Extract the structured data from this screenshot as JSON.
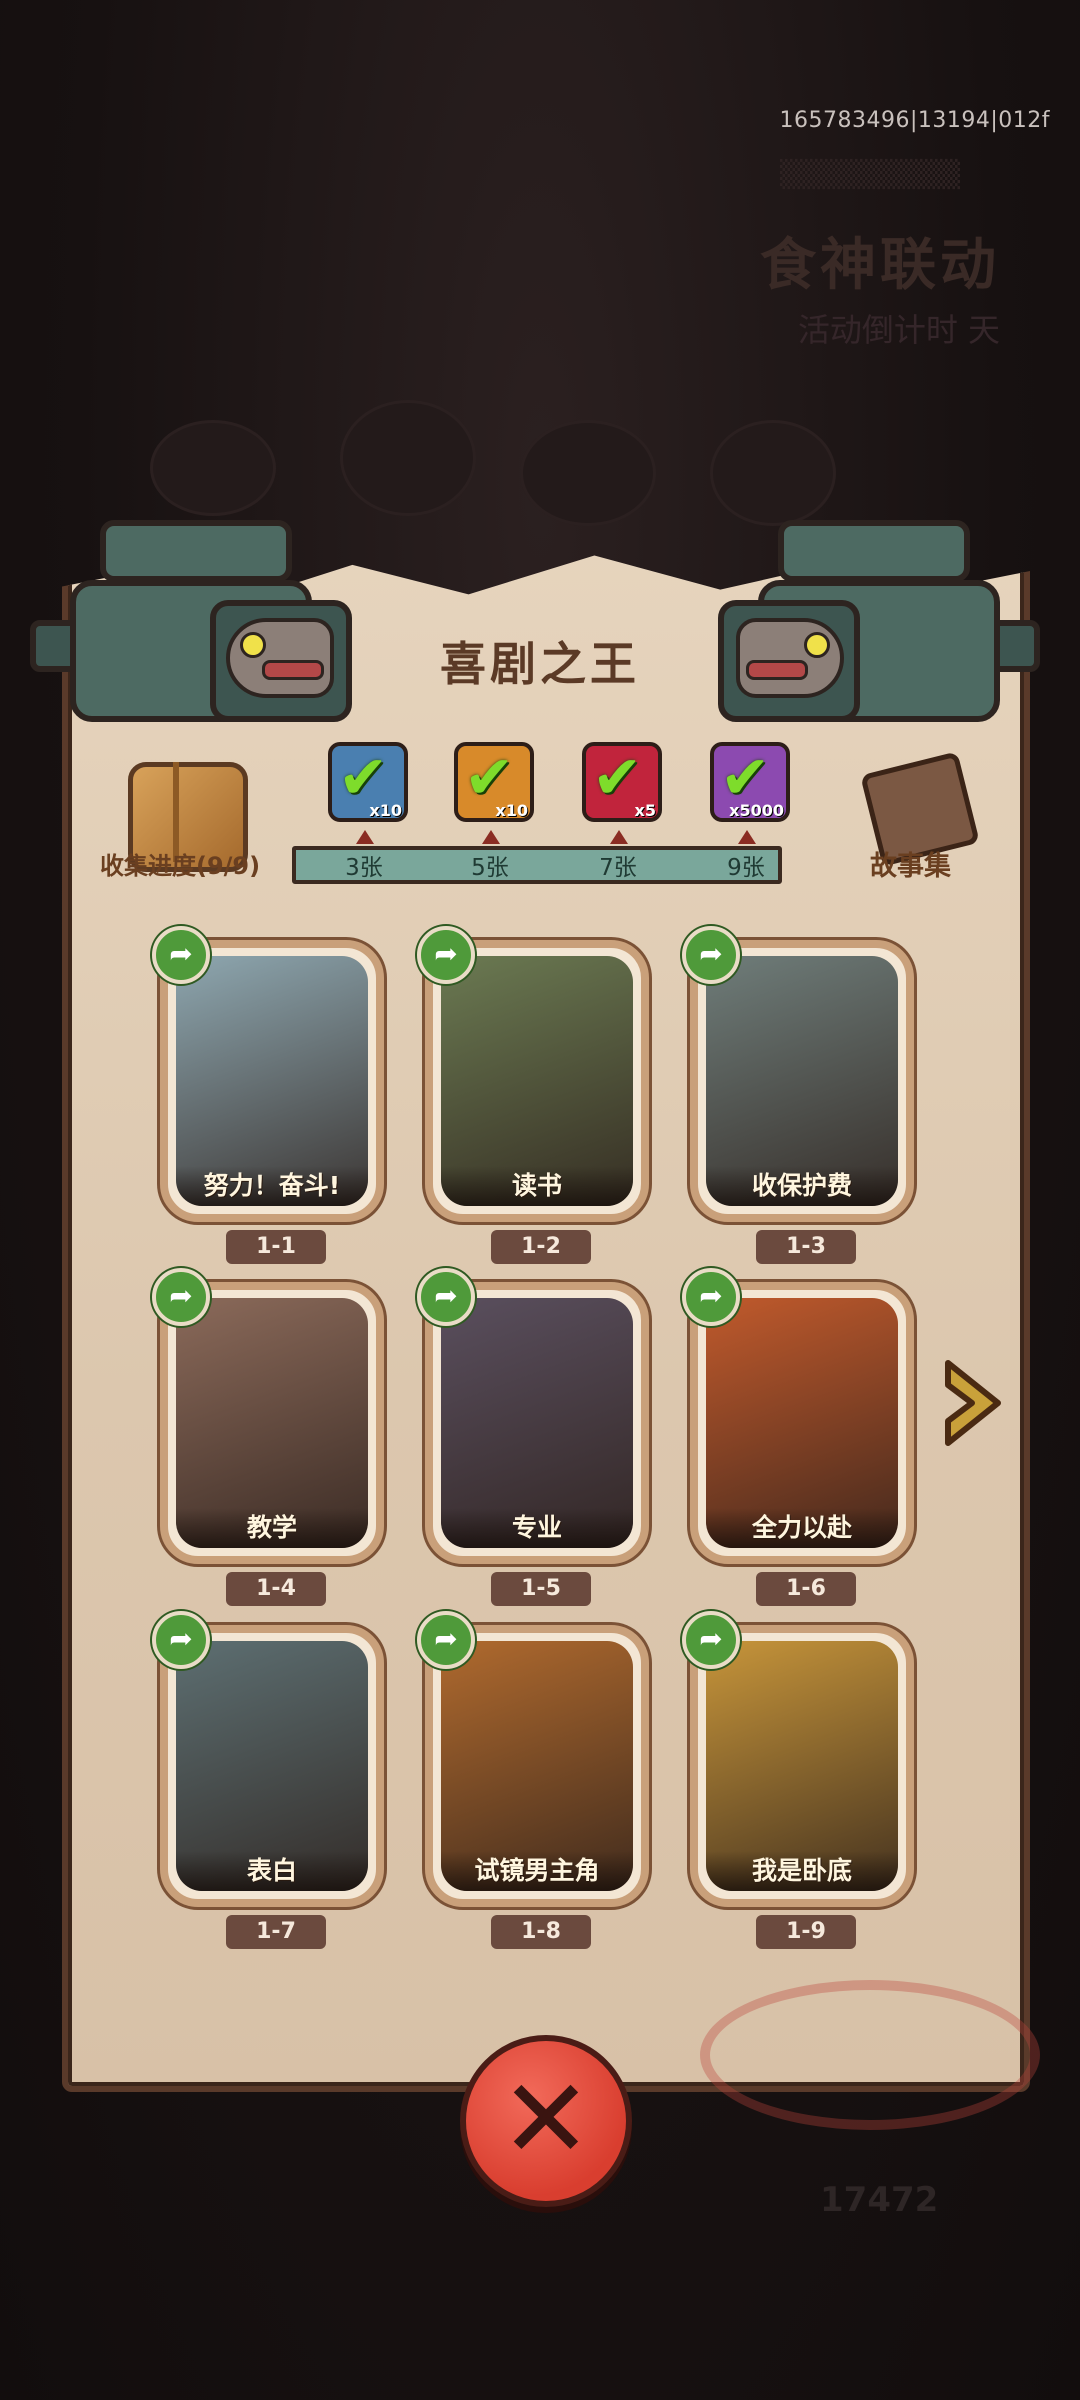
{
  "build_id": "165783496|13194|012f",
  "background": {
    "event_title": "食神联动",
    "event_subtitle": "活动倒计时 天",
    "bottom_number": "17472"
  },
  "panel": {
    "title": "喜剧之王",
    "collect_label": "收集进度(9/9)",
    "story_label": "故事集",
    "milestones": [
      {
        "count": "x10",
        "label": "3张",
        "color": "#4a7fb0",
        "icon": "card-pack-icon"
      },
      {
        "count": "x10",
        "label": "5张",
        "color": "#d88a2a",
        "icon": "card-pack-icon"
      },
      {
        "count": "x5",
        "label": "7张",
        "color": "#c1243c",
        "icon": "gem-icon"
      },
      {
        "count": "x5000",
        "label": "9张",
        "color": "#8c4ab0",
        "icon": "crystal-icon"
      }
    ],
    "cards": [
      {
        "title": "努力！奋斗!",
        "id": "1-1",
        "bg": "#8ea7b0"
      },
      {
        "title": "读书",
        "id": "1-2",
        "bg": "#6b7a52"
      },
      {
        "title": "收保护费",
        "id": "1-3",
        "bg": "#6f7d7a"
      },
      {
        "title": "教学",
        "id": "1-4",
        "bg": "#8b6a5a"
      },
      {
        "title": "专业",
        "id": "1-5",
        "bg": "#5a4f5e"
      },
      {
        "title": "全力以赴",
        "id": "1-6",
        "bg": "#c15a2c"
      },
      {
        "title": "表白",
        "id": "1-7",
        "bg": "#5d6f72"
      },
      {
        "title": "试镜男主角",
        "id": "1-8",
        "bg": "#b06a2e"
      },
      {
        "title": "我是卧底",
        "id": "1-9",
        "bg": "#c7953a"
      }
    ]
  }
}
